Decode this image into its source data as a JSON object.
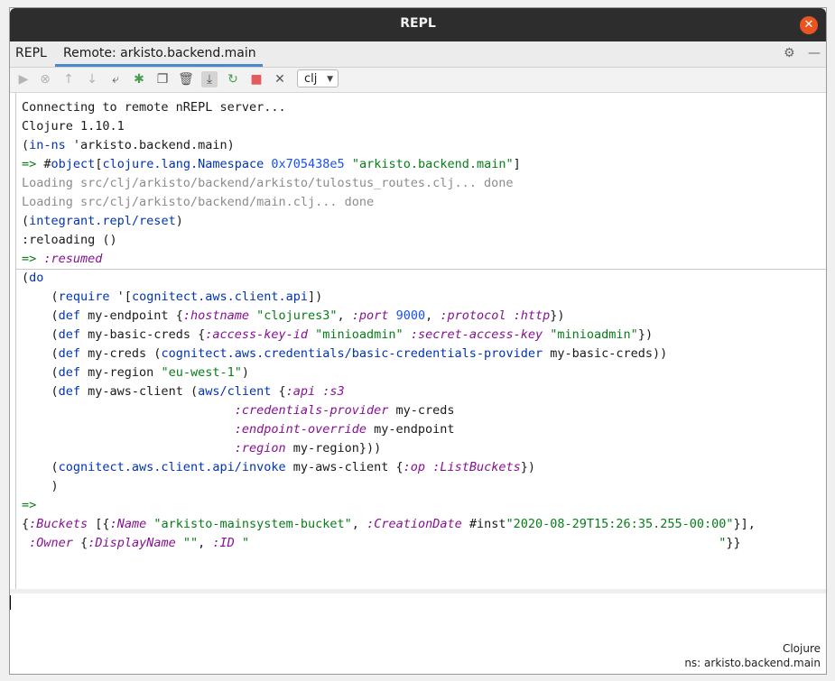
{
  "window": {
    "title": "REPL"
  },
  "tabs": [
    {
      "label": "REPL"
    },
    {
      "label": "Remote: arkisto.backend.main"
    }
  ],
  "tab_tools": {
    "settings_icon": "gear-icon",
    "minimize_icon": "minus-icon",
    "settings_glyph": "⚙",
    "minimize_glyph": "—"
  },
  "toolbar": {
    "icons": [
      "run",
      "stop",
      "previous",
      "next",
      "soft-wrap",
      "debug",
      "copy",
      "clear",
      "scroll-to-end",
      "reload",
      "stop-red",
      "close"
    ],
    "lang_value": "clj"
  },
  "output": {
    "lines": [
      "Connecting to remote nREPL server...",
      "Clojure 1.10.1",
      "(in-ns 'arkisto.backend.main)",
      "=> #object[clojure.lang.Namespace 0x705438e5 \"arkisto.backend.main\"]",
      "Loading src/clj/arkisto/backend/arkisto/tulostus_routes.clj... done",
      "Loading src/clj/arkisto/backend/main.clj... done",
      "(integrant.repl/reset)",
      ":reloading ()",
      "=> :resumed",
      "(do",
      "    (require '[cognitect.aws.client.api])",
      "    (def my-endpoint {:hostname \"clojures3\", :port 9000, :protocol :http})",
      "    (def my-basic-creds {:access-key-id \"minioadmin\" :secret-access-key \"minioadmin\"})",
      "    (def my-creds (cognitect.aws.credentials/basic-credentials-provider my-basic-creds))",
      "    (def my-region \"eu-west-1\")",
      "    (def my-aws-client (aws/client {:api :s3",
      "                             :credentials-provider my-creds",
      "                             :endpoint-override my-endpoint",
      "                             :region my-region}))",
      "    (cognitect.aws.client.api/invoke my-aws-client {:op :ListBuckets})",
      "    )",
      "=>",
      "{:Buckets [{:Name \"arkisto-mainsystem-bucket\", :CreationDate #inst\"2020-08-29T15:26:35.255-00:00\"}],",
      " :Owner {:DisplayName \"\", :ID \"                                                                \"}}"
    ]
  },
  "status": {
    "language": "Clojure",
    "namespace": "ns: arkisto.backend.main"
  },
  "colors": {
    "string": "#067d17",
    "keyword": "#871094",
    "function": "#0033b3",
    "number": "#1750eb",
    "comment_gray": "#8c8c8c",
    "tab_accent": "#4a88c7",
    "close_button": "#e95420"
  }
}
